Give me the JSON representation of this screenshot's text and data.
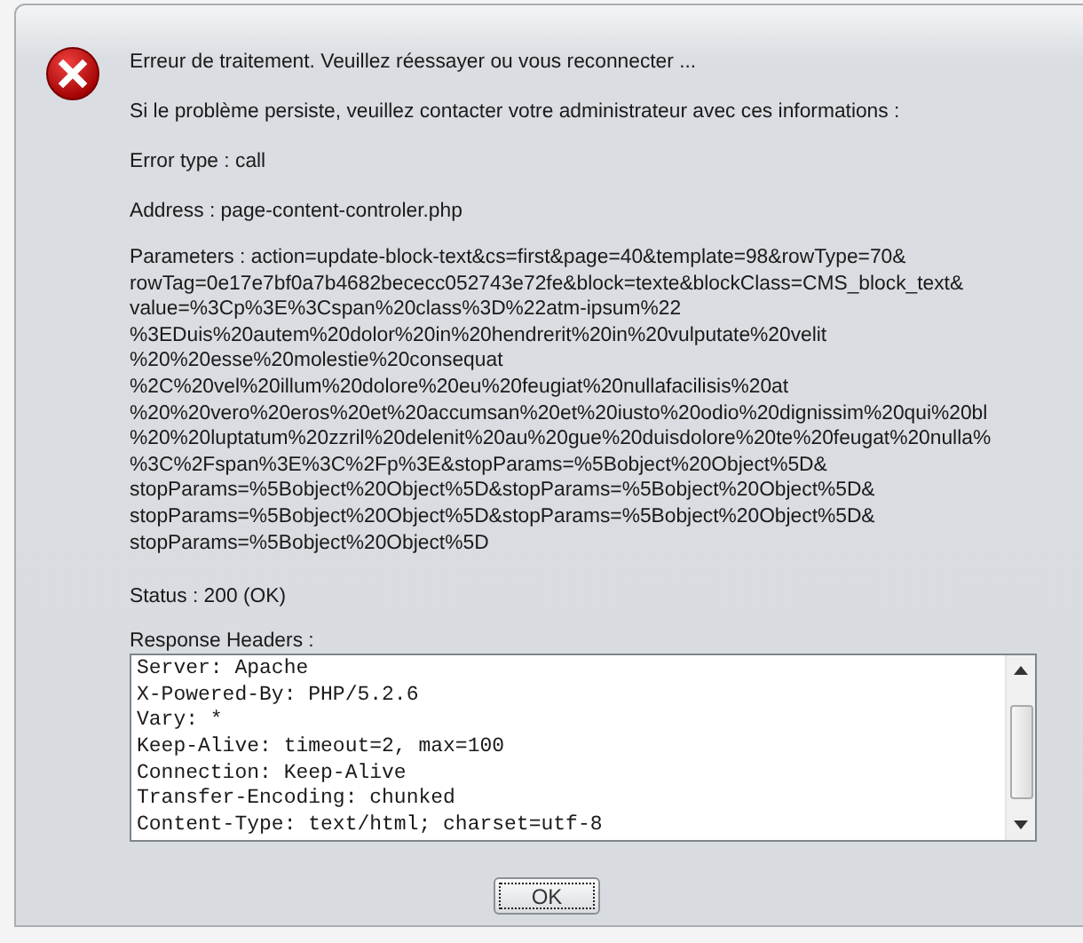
{
  "dialog": {
    "kind": "error",
    "message": "Erreur de traitement. Veuillez réessayer ou vous reconnecter ...",
    "details": [
      "Si le problème persiste, veuillez contacter votre administrateur avec ces informations :",
      "Error type : call",
      "Address : page-content-controler.php"
    ],
    "parameters": [
      "Parameters : action=update-block-text&cs=first&page=40&template=98&rowType=70&",
      "rowTag=0e17e7bf0a7b4682bececc052743e72fe&block=texte&blockClass=CMS_block_text&",
      "value=%3Cp%3E%3Cspan%20class%3D%22atm-ipsum%22",
      "%3EDuis%20autem%20dolor%20in%20hendrerit%20in%20vulputate%20velit",
      "%20%20esse%20molestie%20consequat",
      "%2C%20vel%20illum%20dolore%20eu%20feugiat%20nullafacilisis%20at",
      "%20%20vero%20eros%20et%20accumsan%20et%20iusto%20odio%20dignissim%20qui%20bl",
      "%20%20luptatum%20zzril%20delenit%20au%20gue%20duisdolore%20te%20feugat%20nulla%",
      "%3C%2Fspan%3E%3C%2Fp%3E&stopParams=%5Bobject%20Object%5D&",
      "stopParams=%5Bobject%20Object%5D&stopParams=%5Bobject%20Object%5D&",
      "stopParams=%5Bobject%20Object%5D&stopParams=%5Bobject%20Object%5D&",
      "stopParams=%5Bobject%20Object%5D"
    ],
    "status": "Status : 200 (OK)",
    "headers_label": "Response Headers :",
    "headers": [
      "Server: Apache",
      "X-Powered-By: PHP/5.2.6",
      "Vary: *",
      "Keep-Alive: timeout=2, max=100",
      "Connection: Keep-Alive",
      "Transfer-Encoding: chunked",
      "Content-Type: text/html; charset=utf-8"
    ],
    "button": {
      "label": "OK",
      "focused": true
    }
  }
}
